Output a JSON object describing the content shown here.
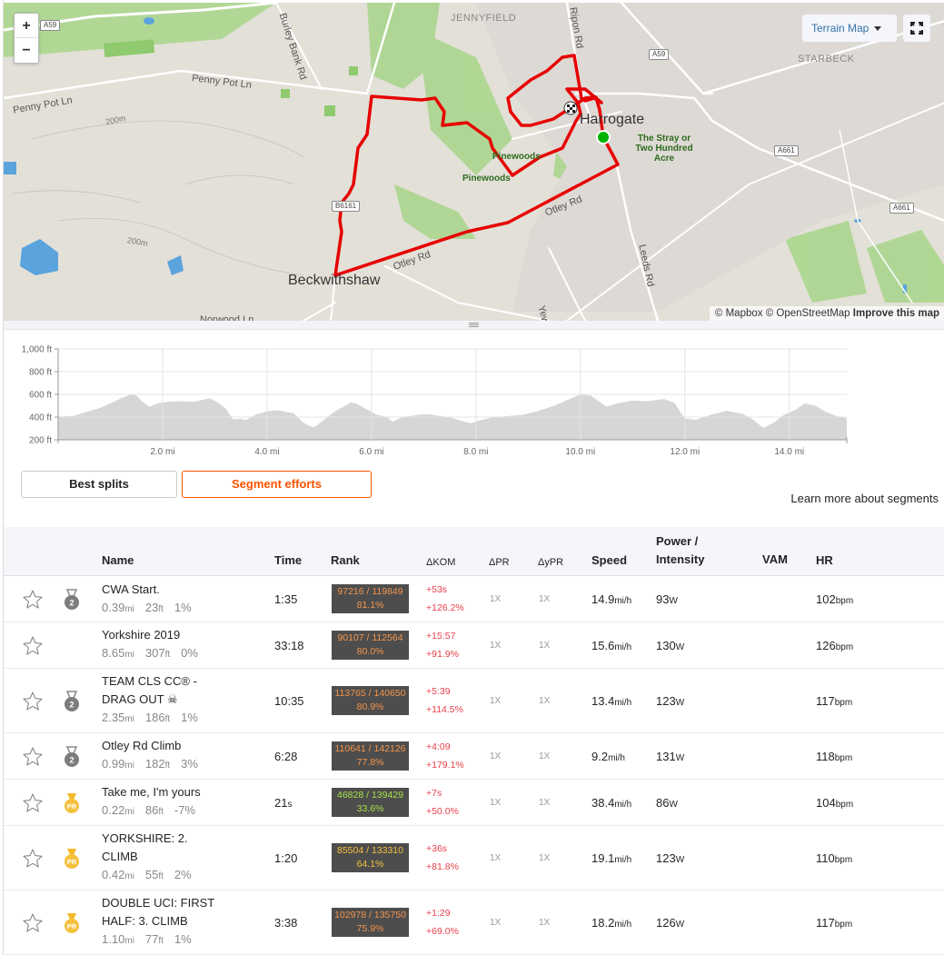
{
  "map": {
    "zoom_in_label": "+",
    "zoom_out_label": "−",
    "map_type_label": "Terrain Map",
    "fullscreen_icon": "expand-icon",
    "attribution_mapbox": "© Mapbox",
    "attribution_osm": "© OpenStreetMap",
    "attribution_improve": "Improve this map",
    "labels": {
      "jennyfield": "JENNYFIELD",
      "starbeck": "STARBECK",
      "harrogate": "Harrogate",
      "beckwithshaw": "Beckwithshaw",
      "stray": "The Stray or Two Hundred Acre",
      "pinewoods1": "Pinewoods",
      "pinewoods2": "Pinewoods",
      "penny_pot_1": "Penny Pot Ln",
      "penny_pot_2": "Penny Pot Ln",
      "burley_bank": "Burley Bank Rd",
      "ripon_rd": "Ripon Rd",
      "otley_rd_1": "Otley Rd",
      "otley_rd_2": "Otley Rd",
      "leeds_rd": "Leeds Rd",
      "norwood_ln": "Norwood Ln",
      "yew": "Yew",
      "contour_1": "200m",
      "contour_2": "200m",
      "shield_a59_1": "A59",
      "shield_a59_2": "A59",
      "shield_a661_1": "A661",
      "shield_a661_2": "A661",
      "shield_b6161": "B6161"
    }
  },
  "chart_data": {
    "type": "area",
    "title": "",
    "xlabel": "",
    "ylabel": "",
    "x_unit": "mi",
    "y_unit": "ft",
    "xlim": [
      0,
      15.1
    ],
    "ylim": [
      200,
      1000
    ],
    "y_ticks": [
      "1,000 ft",
      "800 ft",
      "600 ft",
      "400 ft",
      "200 ft"
    ],
    "y_tick_values": [
      1000,
      800,
      600,
      400,
      200
    ],
    "x_ticks": [
      "2.0 mi",
      "4.0 mi",
      "6.0 mi",
      "8.0 mi",
      "10.0 mi",
      "12.0 mi",
      "14.0 mi"
    ],
    "x_tick_values": [
      2,
      4,
      6,
      8,
      10,
      12,
      14
    ],
    "grid": true,
    "fill_color": "#d6d6d6",
    "x": [
      0,
      0.3,
      0.5,
      0.8,
      1.0,
      1.2,
      1.4,
      1.5,
      1.6,
      1.75,
      1.9,
      2.1,
      2.3,
      2.6,
      2.8,
      2.9,
      3.05,
      3.2,
      3.35,
      3.5,
      3.6,
      3.8,
      4.0,
      4.2,
      4.5,
      4.7,
      4.8,
      4.9,
      5.1,
      5.3,
      5.5,
      5.6,
      5.7,
      5.9,
      6.1,
      6.3,
      6.4,
      6.6,
      6.9,
      7.1,
      7.3,
      7.5,
      7.7,
      7.9,
      8.1,
      8.3,
      8.5,
      8.9,
      9.2,
      9.5,
      9.8,
      10.0,
      10.2,
      10.5,
      10.7,
      11.0,
      11.3,
      11.6,
      11.8,
      12.0,
      12.1,
      12.2,
      12.5,
      12.8,
      13.1,
      13.3,
      13.5,
      13.7,
      13.9,
      14.1,
      14.3,
      14.5,
      14.7,
      14.9,
      15.1
    ],
    "values": [
      405,
      410,
      440,
      480,
      520,
      565,
      600,
      590,
      540,
      490,
      520,
      535,
      540,
      535,
      555,
      565,
      530,
      480,
      380,
      385,
      375,
      425,
      450,
      460,
      435,
      350,
      325,
      310,
      380,
      450,
      500,
      530,
      520,
      470,
      420,
      400,
      360,
      400,
      420,
      425,
      410,
      400,
      370,
      345,
      375,
      395,
      405,
      420,
      455,
      500,
      560,
      600,
      590,
      490,
      520,
      545,
      540,
      560,
      525,
      385,
      385,
      375,
      420,
      455,
      430,
      380,
      305,
      350,
      420,
      460,
      520,
      500,
      445,
      410,
      390
    ]
  },
  "tabs": {
    "best_splits": "Best splits",
    "segment_efforts": "Segment efforts",
    "active": "segment_efforts"
  },
  "learn_more": "Learn more about segments",
  "table": {
    "headers": {
      "name": "Name",
      "time": "Time",
      "rank": "Rank",
      "dkom": "ΔKOM",
      "dpr": "ΔPR",
      "dypr": "ΔyPR",
      "speed": "Speed",
      "power_1": "Power /",
      "power_2": "Intensity",
      "vam": "VAM",
      "hr": "HR"
    },
    "units": {
      "dist": "mi",
      "elev": "ft",
      "speed": "mi/h",
      "power": "W",
      "hr": "bpm",
      "sec": "s"
    },
    "rows": [
      {
        "starred": false,
        "medal": "2",
        "medal_type": "silver",
        "name_1": "CWA Start.",
        "name_2": "",
        "dist": "0.39",
        "elev": "23",
        "grade": "1%",
        "time": "1:35",
        "time_unit": "",
        "rank": "97216 / 119849",
        "rank_pct": "81.1%",
        "rank_color": "#f5954c",
        "kom_time": "+53s",
        "kom_pct": "+126.2%",
        "dpr": "1X",
        "dypr": "1X",
        "speed": "14.9",
        "power": "93",
        "vam": "",
        "hr": "102"
      },
      {
        "starred": false,
        "medal": "",
        "medal_type": "none",
        "name_1": "Yorkshire 2019",
        "name_2": "",
        "dist": "8.65",
        "elev": "307",
        "grade": "0%",
        "time": "33:18",
        "time_unit": "",
        "rank": "90107 / 112564",
        "rank_pct": "80.0%",
        "rank_color": "#f5954c",
        "kom_time": "+15:57",
        "kom_pct": "+91.9%",
        "dpr": "1X",
        "dypr": "1X",
        "speed": "15.6",
        "power": "130",
        "vam": "",
        "hr": "126"
      },
      {
        "starred": false,
        "medal": "2",
        "medal_type": "silver",
        "name_1": "TEAM CLS CC® -",
        "name_2": "DRAG OUT ☠",
        "dist": "2.35",
        "elev": "186",
        "grade": "1%",
        "time": "10:35",
        "time_unit": "",
        "rank": "113765 / 140650",
        "rank_pct": "80.9%",
        "rank_color": "#f5954c",
        "kom_time": "+5:39",
        "kom_pct": "+114.5%",
        "dpr": "1X",
        "dypr": "1X",
        "speed": "13.4",
        "power": "123",
        "vam": "",
        "hr": "117"
      },
      {
        "starred": false,
        "medal": "2",
        "medal_type": "silver",
        "name_1": "Otley Rd Climb",
        "name_2": "",
        "dist": "0.99",
        "elev": "182",
        "grade": "3%",
        "time": "6:28",
        "time_unit": "",
        "rank": "110641 / 142126",
        "rank_pct": "77.8%",
        "rank_color": "#f5954c",
        "kom_time": "+4:09",
        "kom_pct": "+179.1%",
        "dpr": "1X",
        "dypr": "1X",
        "speed": "9.2",
        "power": "131",
        "vam": "",
        "hr": "118"
      },
      {
        "starred": false,
        "medal": "PR",
        "medal_type": "gold",
        "name_1": "Take me, I'm yours",
        "name_2": "",
        "dist": "0.22",
        "elev": "86",
        "grade": "-7%",
        "time": "21",
        "time_unit": "s",
        "rank": "46828 / 139429",
        "rank_pct": "33.6%",
        "rank_color": "#a5e14a",
        "kom_time": "+7s",
        "kom_pct": "+50.0%",
        "dpr": "1X",
        "dypr": "1X",
        "speed": "38.4",
        "power": "86",
        "vam": "",
        "hr": "104"
      },
      {
        "starred": false,
        "medal": "PR",
        "medal_type": "gold",
        "name_1": "YORKSHIRE: 2.",
        "name_2": "CLIMB",
        "dist": "0.42",
        "elev": "55",
        "grade": "2%",
        "time": "1:20",
        "time_unit": "",
        "rank": "85504 / 133310",
        "rank_pct": "64.1%",
        "rank_color": "#f6c13e",
        "kom_time": "+36s",
        "kom_pct": "+81.8%",
        "dpr": "1X",
        "dypr": "1X",
        "speed": "19.1",
        "power": "123",
        "vam": "",
        "hr": "110"
      },
      {
        "starred": false,
        "medal": "PR",
        "medal_type": "gold",
        "name_1": "DOUBLE UCI: FIRST",
        "name_2": "HALF: 3. CLIMB",
        "dist": "1.10",
        "elev": "77",
        "grade": "1%",
        "time": "3:38",
        "time_unit": "",
        "rank": "102978 / 135750",
        "rank_pct": "75.9%",
        "rank_color": "#f5954c",
        "kom_time": "+1:29",
        "kom_pct": "+69.0%",
        "dpr": "1X",
        "dypr": "1X",
        "speed": "18.2",
        "power": "126",
        "vam": "",
        "hr": "117"
      }
    ]
  }
}
